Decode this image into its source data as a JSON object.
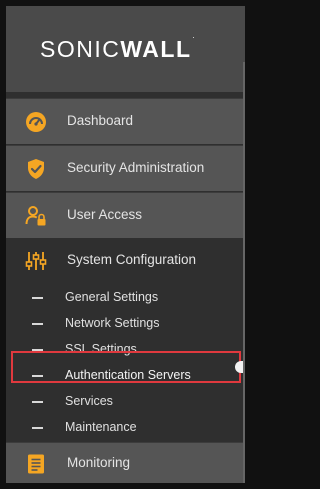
{
  "brand": {
    "logo_thin": "SONIC",
    "logo_bold": "WALL",
    "logo_mark": "."
  },
  "colors": {
    "accent_orange": "#f5a623",
    "highlight_red": "#e0393e",
    "panel_dark": "#2f2f2f",
    "panel_mid": "#555555"
  },
  "nav": {
    "dashboard": {
      "label": "Dashboard",
      "icon": "dashboard-gauge-icon"
    },
    "security": {
      "label": "Security Administration",
      "icon": "shield-check-icon"
    },
    "user_access": {
      "label": "User Access",
      "icon": "user-lock-icon"
    },
    "system_configuration": {
      "label": "System Configuration",
      "icon": "sliders-icon",
      "items": [
        {
          "label": "General Settings"
        },
        {
          "label": "Network Settings"
        },
        {
          "label": "SSL Settings"
        },
        {
          "label": "Authentication Servers",
          "selected": true
        },
        {
          "label": "Services"
        },
        {
          "label": "Maintenance"
        }
      ]
    },
    "monitoring": {
      "label": "Monitoring",
      "icon": "document-list-icon"
    }
  }
}
